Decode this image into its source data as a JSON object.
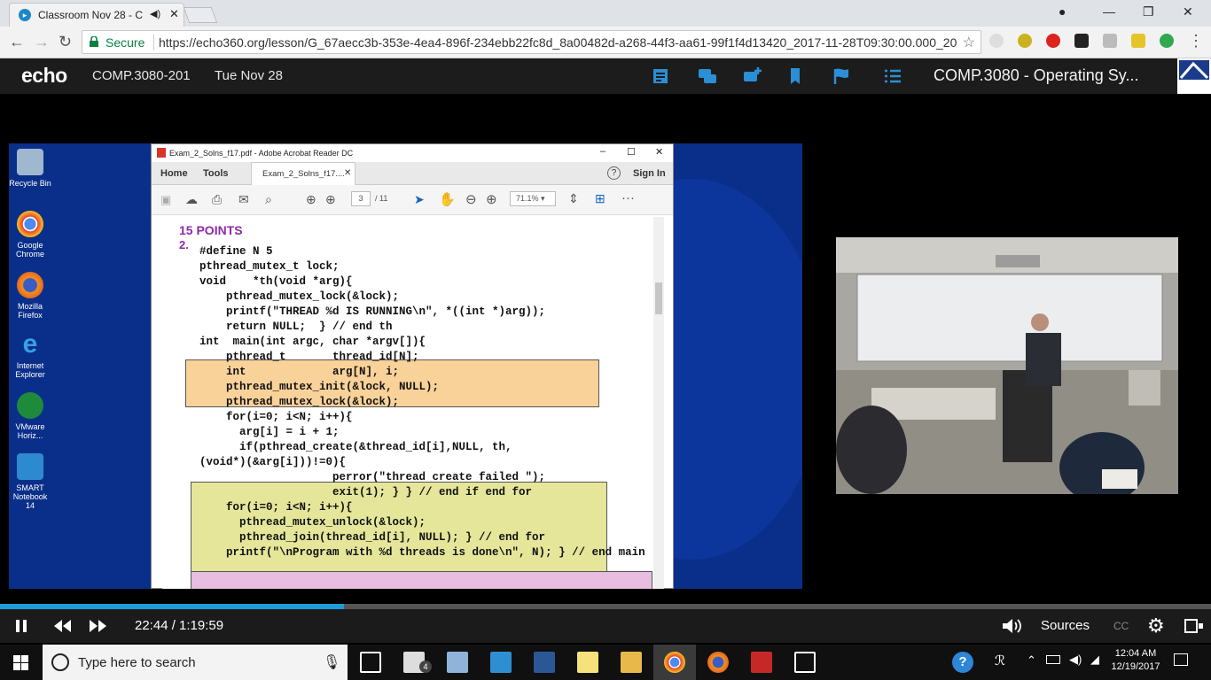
{
  "browser": {
    "tab_title": "Classroom Nov 28 - C",
    "secure_label": "Secure",
    "url": "https://echo360.org/lesson/G_67aecc3b-353e-4ea4-896f-234ebb22fc8d_8a00482d-a268-44f3-aa61-99f1f4d13420_2017-11-28T09:30:00.000_20..."
  },
  "echo": {
    "logo": "echo",
    "course_code": "COMP.3080-201",
    "date": "Tue Nov 28",
    "course_title": "COMP.3080 - Operating Sy...",
    "umass_label": "UMASS LOWELL"
  },
  "desktop": {
    "icons": [
      {
        "label": "Recycle Bin",
        "icon": "recycle-bin-icon"
      },
      {
        "label": "Google Chrome",
        "icon": "chrome-icon"
      },
      {
        "label": "Mozilla Firefox",
        "icon": "firefox-icon"
      },
      {
        "label": "Internet Explorer",
        "icon": "ie-icon"
      },
      {
        "label": "VMware Horiz...",
        "icon": "vmware-icon"
      },
      {
        "label": "SMART Notebook 14",
        "icon": "smart-notebook-icon"
      }
    ]
  },
  "acrobat": {
    "window_title": "Exam_2_Solns_f17.pdf - Adobe Acrobat Reader DC",
    "home_tab": "Home",
    "tools_tab": "Tools",
    "doc_tab": "Exam_2_Solns_f17....",
    "sign_in": "Sign In",
    "page_current": "3",
    "page_total": "/ 11",
    "zoom": "71.1%",
    "content": {
      "heading": "15 POINTS",
      "number": "2.",
      "lines": [
        "#define N 5",
        "pthread_mutex_t lock;",
        "void    *th(void *arg){",
        "    pthread_mutex_lock(&lock);",
        "    printf(\"THREAD %d IS RUNNING\\n\", *((int *)arg));",
        "    return NULL;  } // end th",
        "int  main(int argc, char *argv[]){",
        "    pthread_t       thread_id[N];",
        "    int             arg[N], i;",
        "    pthread_mutex_init(&lock, NULL);",
        "    pthread_mutex_lock(&lock);",
        "    for(i=0; i<N; i++){",
        "      arg[i] = i + 1;",
        "      if(pthread_create(&thread_id[i],NULL, th,",
        "(void*)(&arg[i]))!=0){",
        "                    perror(\"thread create failed \");",
        "                    exit(1); } } // end if end for",
        "    for(i=0; i<N; i++){",
        "      pthread_mutex_unlock(&lock);",
        "      pthread_join(thread_id[i], NULL); } // end for",
        "    printf(\"\\nProgram with %d threads is done\\n\", N); } // end main"
      ]
    }
  },
  "player": {
    "progress": 0.284,
    "time": "22:44 / 1:19:59",
    "sources_label": "Sources",
    "cc_label": "CC"
  },
  "taskbar": {
    "search_placeholder": "Type here to search",
    "mail_badge": "4",
    "clock_time": "12:04 AM",
    "clock_date": "12/19/2017"
  },
  "colors": {
    "orange_box": "#f9d29a",
    "green_box": "#e5e69a",
    "pink_box": "#e7bedf",
    "heading_purple": "#8e2aa8",
    "progress_blue": "#1e9ad6"
  }
}
